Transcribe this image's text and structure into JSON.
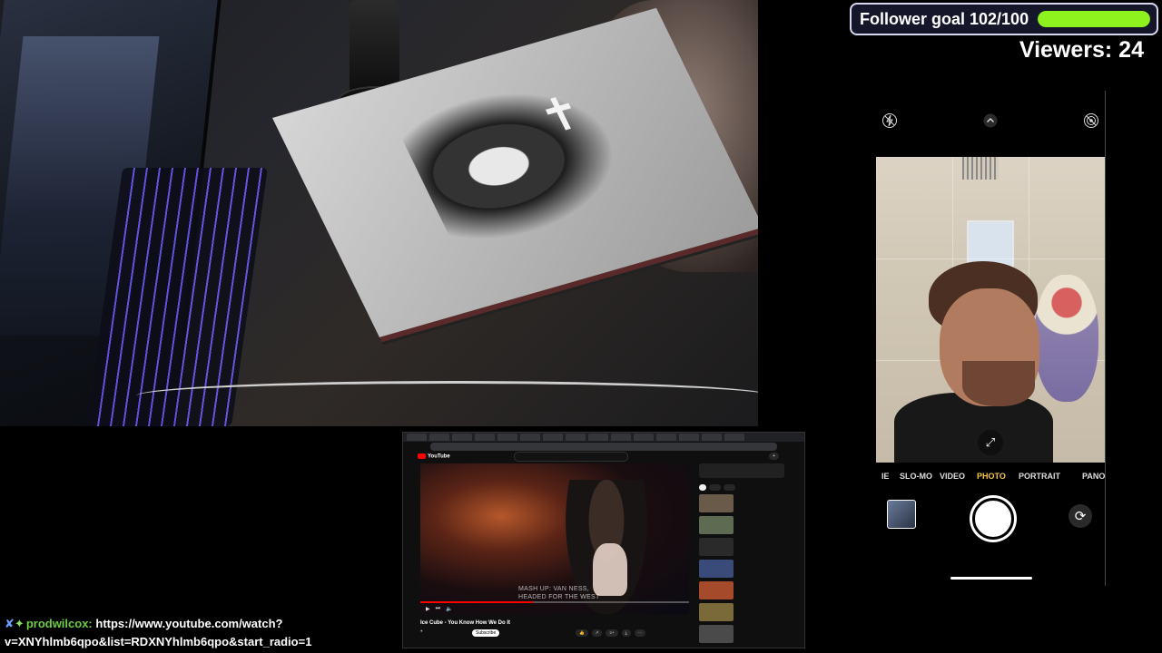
{
  "overlay": {
    "follower_goal_label": "Follower goal 102/100",
    "follower_goal_progress": 1.0,
    "viewers_label": "Viewers: 24"
  },
  "phone_camera": {
    "modes": [
      "IE",
      "SLO-MO",
      "VIDEO",
      "PHOTO",
      "PORTRAIT",
      "PANO"
    ],
    "active_mode": "PHOTO"
  },
  "youtube": {
    "video_caption_line1": "MASH UP: VAN NESS,",
    "video_caption_line2": "HEADED FOR THE WEST",
    "video_title": "Ice Cube - You Know How We Do It",
    "subscribe_label": "Subscribe"
  },
  "chat": {
    "username": "prodwilcox:",
    "message_line1": "https://www.youtube.com/watch?",
    "message_line2": "v=XNYhlmb6qpo&list=RDXNYhlmb6qpo&start_radio=1"
  },
  "colors": {
    "goal_fill": "#8df21d",
    "chat_username": "#6fce41",
    "active_camera_mode": "#f6c445",
    "youtube_red": "#ff0000"
  }
}
